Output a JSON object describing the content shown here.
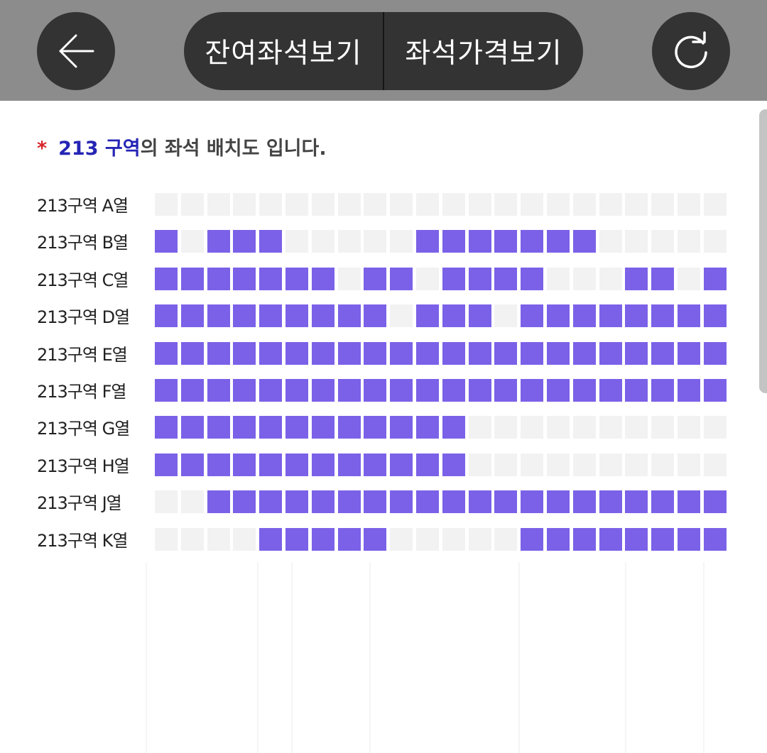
{
  "toolbar": {
    "back_label": "뒤로",
    "remaining_seats_label": "잔여좌석보기",
    "seat_price_label": "좌석가격보기",
    "refresh_label": "새로고침"
  },
  "headline": {
    "star": "*",
    "section": "213 구역",
    "suffix": "의 좌석 배치도 입니다."
  },
  "colors": {
    "available": "#7b61e8",
    "unavailable": "#f2f2f2",
    "section_text": "#2525b5",
    "star": "#d8232a"
  },
  "rows": [
    {
      "label": "213구역 A열",
      "seats": [
        0,
        0,
        0,
        0,
        0,
        0,
        0,
        0,
        0,
        0,
        0,
        0,
        0,
        0,
        0,
        0,
        0,
        0,
        0,
        0,
        0,
        0
      ]
    },
    {
      "label": "213구역 B열",
      "seats": [
        1,
        0,
        1,
        1,
        1,
        0,
        0,
        0,
        0,
        0,
        1,
        1,
        1,
        1,
        1,
        1,
        1,
        0,
        0,
        0,
        0,
        0
      ]
    },
    {
      "label": "213구역 C열",
      "seats": [
        1,
        1,
        1,
        1,
        1,
        1,
        1,
        0,
        1,
        1,
        0,
        1,
        1,
        1,
        1,
        0,
        0,
        0,
        1,
        1,
        0,
        1
      ]
    },
    {
      "label": "213구역 D열",
      "seats": [
        1,
        1,
        1,
        1,
        1,
        1,
        1,
        1,
        1,
        0,
        1,
        1,
        1,
        0,
        1,
        1,
        1,
        1,
        1,
        1,
        1,
        1
      ]
    },
    {
      "label": "213구역 E열",
      "seats": [
        1,
        1,
        1,
        1,
        1,
        1,
        1,
        1,
        1,
        1,
        1,
        1,
        1,
        1,
        1,
        1,
        1,
        1,
        1,
        1,
        1,
        1
      ]
    },
    {
      "label": "213구역 F열",
      "seats": [
        1,
        1,
        1,
        1,
        1,
        1,
        1,
        1,
        1,
        1,
        1,
        1,
        1,
        1,
        1,
        1,
        1,
        1,
        1,
        1,
        1,
        1
      ]
    },
    {
      "label": "213구역 G열",
      "seats": [
        1,
        1,
        1,
        1,
        1,
        1,
        1,
        1,
        1,
        1,
        1,
        1,
        0,
        0,
        0,
        0,
        0,
        0,
        0,
        0,
        0,
        0
      ]
    },
    {
      "label": "213구역 H열",
      "seats": [
        1,
        1,
        1,
        1,
        1,
        1,
        1,
        1,
        1,
        1,
        1,
        1,
        0,
        0,
        0,
        0,
        0,
        0,
        0,
        0,
        0,
        0
      ]
    },
    {
      "label": "213구역 J열",
      "seats": [
        0,
        0,
        1,
        1,
        1,
        1,
        1,
        1,
        1,
        1,
        1,
        1,
        1,
        1,
        1,
        1,
        1,
        1,
        1,
        1,
        1,
        1
      ]
    },
    {
      "label": "213구역 K열",
      "seats": [
        0,
        0,
        0,
        0,
        1,
        1,
        1,
        1,
        1,
        0,
        0,
        0,
        0,
        0,
        1,
        1,
        1,
        1,
        1,
        1,
        1,
        1
      ]
    }
  ]
}
